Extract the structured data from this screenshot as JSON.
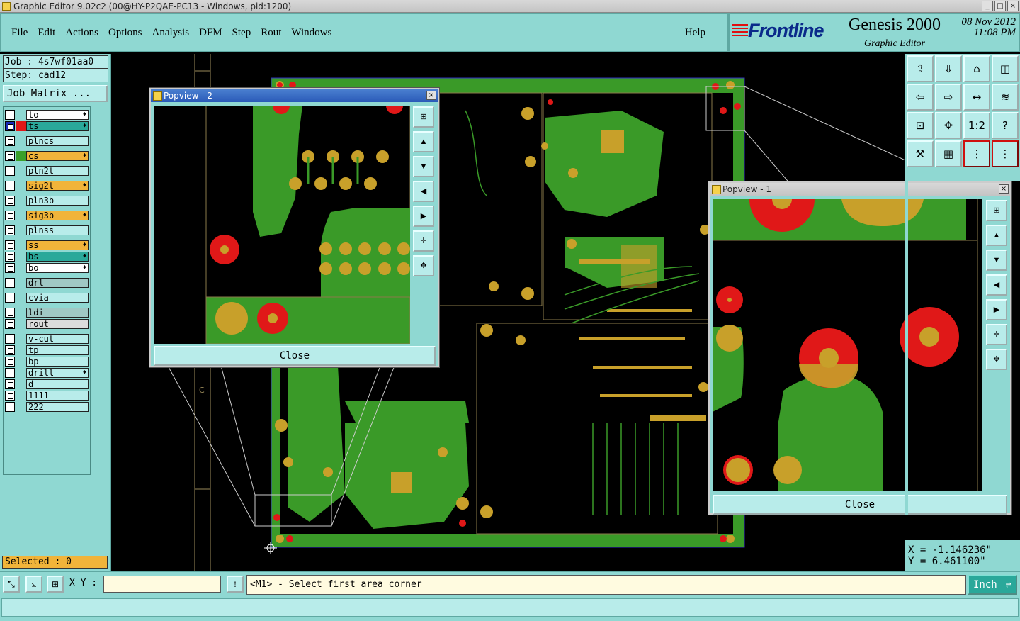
{
  "window": {
    "title": "Graphic Editor 9.02c2 (00@HY-P2QAE-PC13 - Windows, pid:1200)"
  },
  "menu": {
    "items": [
      "File",
      "Edit",
      "Actions",
      "Options",
      "Analysis",
      "DFM",
      "Step",
      "Rout",
      "Windows"
    ],
    "help": "Help"
  },
  "brand": {
    "logo": "Frontline",
    "product": "Genesis 2000",
    "subtitle": "Graphic Editor",
    "date": "08 Nov 2012",
    "time": "11:08 PM"
  },
  "job": {
    "job_label": "Job : 4s7wf01aa0",
    "step_label": "Step: cad12",
    "matrix_button": "Job Matrix ..."
  },
  "layers": [
    {
      "name": "to",
      "color": "#ffffff",
      "mark": true
    },
    {
      "name": "ts",
      "color": "#2aa89a",
      "mark": true,
      "selected": true,
      "swatch": "#e01818"
    },
    {
      "name": "plncs",
      "color": "#b8ecea",
      "mark": false
    },
    {
      "name": "cs",
      "color": "#f1b43a",
      "mark": true,
      "swatch": "#3aa02a"
    },
    {
      "name": "pln2t",
      "color": "#b8ecea",
      "mark": false
    },
    {
      "name": "sig2t",
      "color": "#f1b43a",
      "mark": true
    },
    {
      "name": "pln3b",
      "color": "#b8ecea",
      "mark": false
    },
    {
      "name": "sig3b",
      "color": "#f1b43a",
      "mark": true
    },
    {
      "name": "plnss",
      "color": "#b8ecea",
      "mark": false
    },
    {
      "name": "ss",
      "color": "#f1b43a",
      "mark": true
    },
    {
      "name": "bs",
      "color": "#2aa89a",
      "mark": true
    },
    {
      "name": "bo",
      "color": "#ffffff",
      "mark": true
    },
    {
      "name": "drl",
      "color": "#a0c8c4",
      "mark": false
    },
    {
      "name": "cvia",
      "color": "#b8ecea",
      "mark": false
    },
    {
      "name": "ldi",
      "color": "#a0c8c4",
      "mark": false
    },
    {
      "name": "rout",
      "color": "#dcdcdc",
      "mark": false
    },
    {
      "name": "v-cut",
      "color": "#b8ecea",
      "mark": false
    },
    {
      "name": "tp",
      "color": "#b8ecea",
      "mark": false
    },
    {
      "name": "bp",
      "color": "#b8ecea",
      "mark": false
    },
    {
      "name": "drill",
      "color": "#b8ecea",
      "mark": true
    },
    {
      "name": "d",
      "color": "#b8ecea",
      "mark": false
    },
    {
      "name": "1111",
      "color": "#b8ecea",
      "mark": false
    },
    {
      "name": "222",
      "color": "#b8ecea",
      "mark": false
    }
  ],
  "selected_label": "Selected : 0",
  "coords": {
    "x": "X = -1.146236\"",
    "y": "Y = 6.461100\""
  },
  "status": {
    "xy_label": "X Y :",
    "xy_value": "",
    "prompt": "<M1> - Select first area corner",
    "unit": "Inch"
  },
  "popview2": {
    "title": "Popview - 2",
    "close": "Close"
  },
  "popview1": {
    "title": "Popview - 1",
    "close": "Close"
  },
  "toolbar_labels": {
    "ratio": "1:2",
    "help": "?"
  },
  "colors": {
    "panel": "#8fd8d2",
    "copper": "#3aa02a",
    "pad": "#c8a02a",
    "mask": "#e01818",
    "board": "#3a9a28"
  }
}
